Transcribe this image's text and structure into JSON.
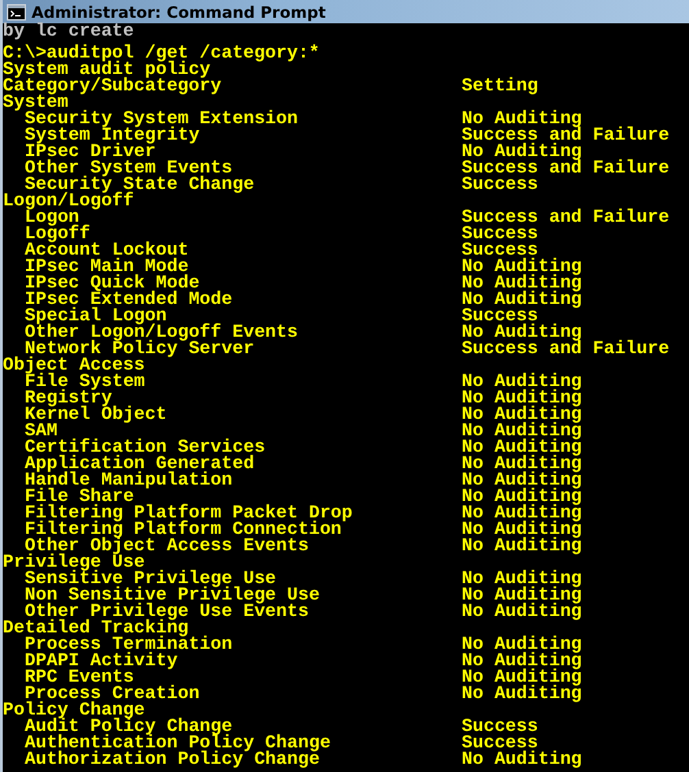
{
  "window": {
    "title": "Administrator: Command Prompt"
  },
  "console": {
    "previous_output": "by lc create",
    "command": "C:\\>auditpol /get /category:*",
    "heading": "System audit policy",
    "columns": [
      "Category/Subcategory",
      "Setting"
    ],
    "categories": [
      {
        "name": "System",
        "items": [
          {
            "name": "Security System Extension",
            "setting": "No Auditing"
          },
          {
            "name": "System Integrity",
            "setting": "Success and Failure"
          },
          {
            "name": "IPsec Driver",
            "setting": "No Auditing"
          },
          {
            "name": "Other System Events",
            "setting": "Success and Failure"
          },
          {
            "name": "Security State Change",
            "setting": "Success"
          }
        ]
      },
      {
        "name": "Logon/Logoff",
        "items": [
          {
            "name": "Logon",
            "setting": "Success and Failure"
          },
          {
            "name": "Logoff",
            "setting": "Success"
          },
          {
            "name": "Account Lockout",
            "setting": "Success"
          },
          {
            "name": "IPsec Main Mode",
            "setting": "No Auditing"
          },
          {
            "name": "IPsec Quick Mode",
            "setting": "No Auditing"
          },
          {
            "name": "IPsec Extended Mode",
            "setting": "No Auditing"
          },
          {
            "name": "Special Logon",
            "setting": "Success"
          },
          {
            "name": "Other Logon/Logoff Events",
            "setting": "No Auditing"
          },
          {
            "name": "Network Policy Server",
            "setting": "Success and Failure"
          }
        ]
      },
      {
        "name": "Object Access",
        "items": [
          {
            "name": "File System",
            "setting": "No Auditing"
          },
          {
            "name": "Registry",
            "setting": "No Auditing"
          },
          {
            "name": "Kernel Object",
            "setting": "No Auditing"
          },
          {
            "name": "SAM",
            "setting": "No Auditing"
          },
          {
            "name": "Certification Services",
            "setting": "No Auditing"
          },
          {
            "name": "Application Generated",
            "setting": "No Auditing"
          },
          {
            "name": "Handle Manipulation",
            "setting": "No Auditing"
          },
          {
            "name": "File Share",
            "setting": "No Auditing"
          },
          {
            "name": "Filtering Platform Packet Drop",
            "setting": "No Auditing"
          },
          {
            "name": "Filtering Platform Connection",
            "setting": "No Auditing"
          },
          {
            "name": "Other Object Access Events",
            "setting": "No Auditing"
          }
        ]
      },
      {
        "name": "Privilege Use",
        "items": [
          {
            "name": "Sensitive Privilege Use",
            "setting": "No Auditing"
          },
          {
            "name": "Non Sensitive Privilege Use",
            "setting": "No Auditing"
          },
          {
            "name": "Other Privilege Use Events",
            "setting": "No Auditing"
          }
        ]
      },
      {
        "name": "Detailed Tracking",
        "items": [
          {
            "name": "Process Termination",
            "setting": "No Auditing"
          },
          {
            "name": "DPAPI Activity",
            "setting": "No Auditing"
          },
          {
            "name": "RPC Events",
            "setting": "No Auditing"
          },
          {
            "name": "Process Creation",
            "setting": "No Auditing"
          }
        ]
      },
      {
        "name": "Policy Change",
        "items": [
          {
            "name": "Audit Policy Change",
            "setting": "Success"
          },
          {
            "name": "Authentication Policy Change",
            "setting": "Success"
          },
          {
            "name": "Authorization Policy Change",
            "setting": "No Auditing"
          }
        ]
      }
    ]
  }
}
